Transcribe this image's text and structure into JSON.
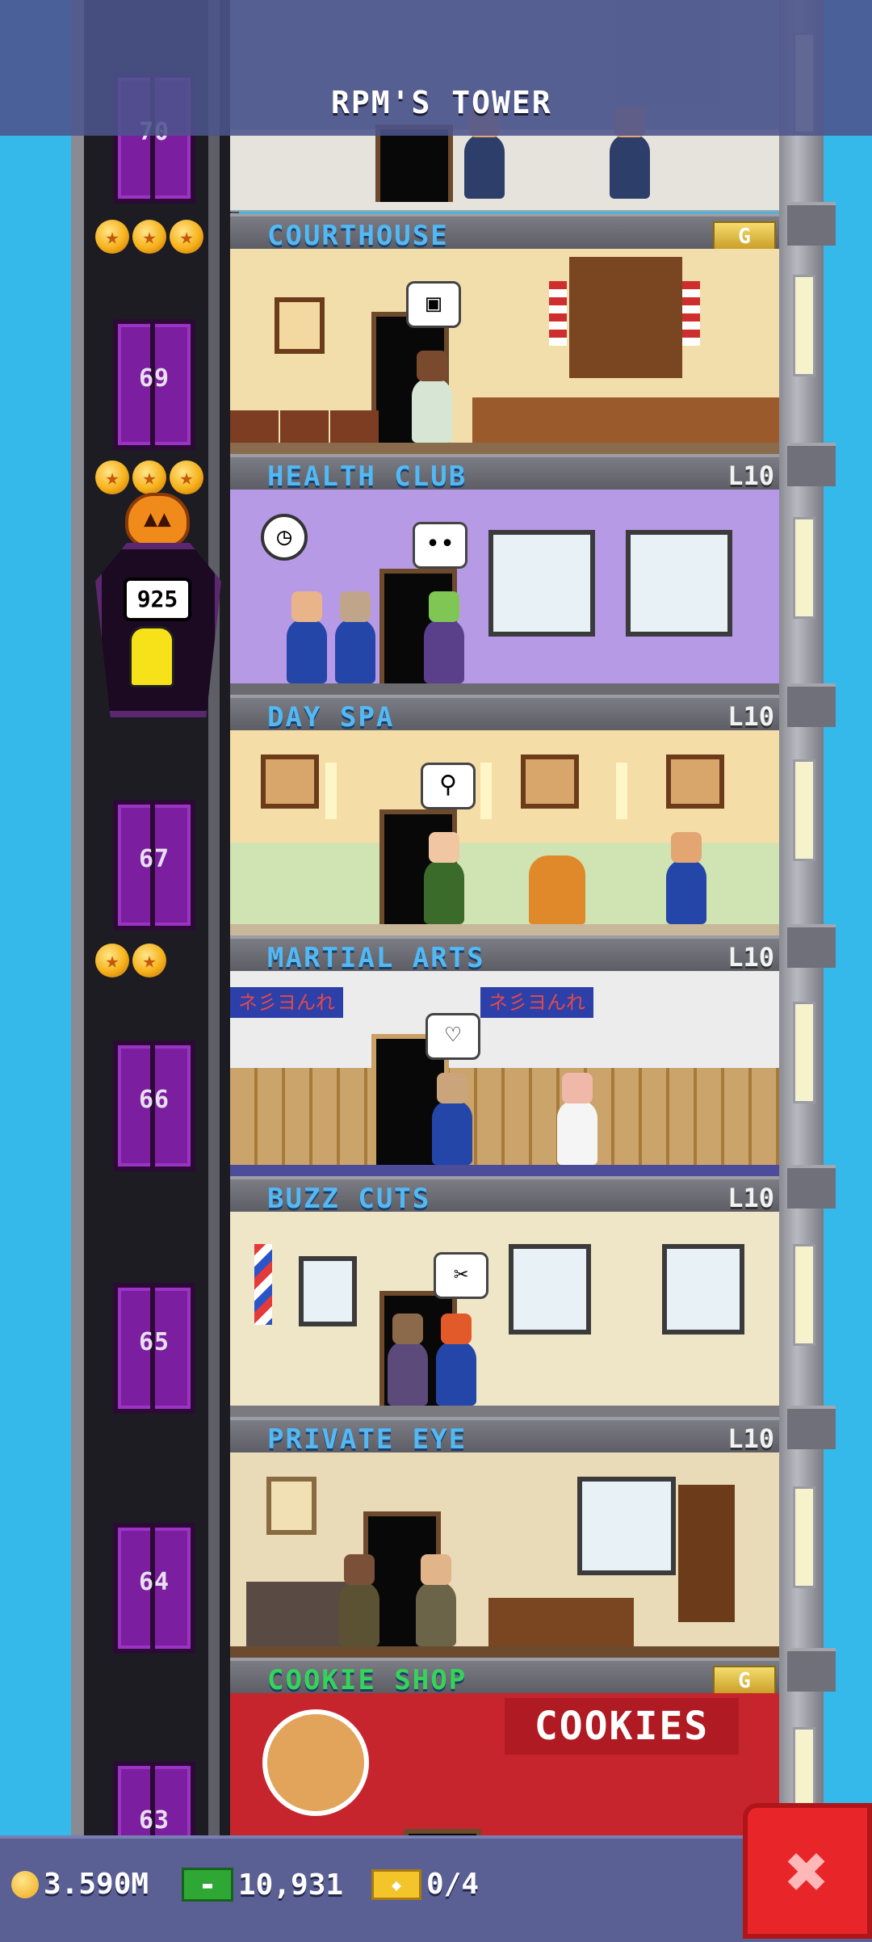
{
  "header": {
    "title": "RPM'S TOWER"
  },
  "elevator": {
    "floor_numbers": [
      "70",
      "69",
      "67",
      "66",
      "65",
      "64",
      "63"
    ],
    "rider_badge": "925"
  },
  "floors": [
    {
      "name": "COURTHOUSE",
      "level": "",
      "badge": "G",
      "name_color": "#52b9f5"
    },
    {
      "name": "HEALTH CLUB",
      "level": "L10",
      "badge": "",
      "name_color": "#52b9f5"
    },
    {
      "name": "DAY SPA",
      "level": "L10",
      "badge": "",
      "name_color": "#52b9f5"
    },
    {
      "name": "MARTIAL ARTS",
      "level": "L10",
      "badge": "",
      "name_color": "#52b9f5"
    },
    {
      "name": "BUZZ CUTS",
      "level": "L10",
      "badge": "",
      "name_color": "#52b9f5"
    },
    {
      "name": "PRIVATE EYE",
      "level": "L10",
      "badge": "",
      "name_color": "#52b9f5"
    },
    {
      "name": "COOKIE SHOP",
      "level": "",
      "badge": "G",
      "name_color": "#35d35a"
    }
  ],
  "signage": {
    "cookies": "COOKIES",
    "martial_banner": "ネ彡ヨんれ"
  },
  "footer": {
    "coins": "3.590M",
    "bux": "10,931",
    "tickets": "0/4"
  },
  "colors": {
    "sky": "#35b8ea",
    "elevator_purple": "#7c1ea0",
    "close_red": "#e8262a",
    "footer_bg": "#5a5f94"
  }
}
